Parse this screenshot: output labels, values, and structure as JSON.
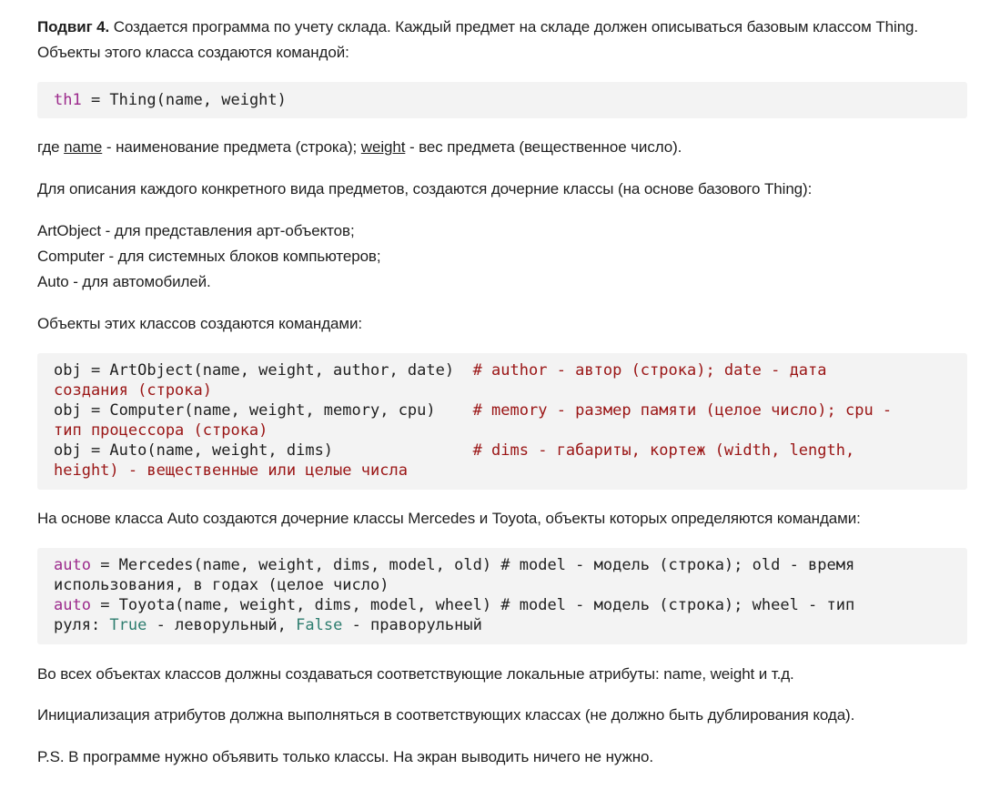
{
  "lead": {
    "title": "Подвиг 4.",
    "text": " Создается программа по учету склада. Каждый предмет на складе должен описываться базовым классом Thing. Объекты этого класса создаются командой:"
  },
  "code1": {
    "var": "th1",
    "rest": " = Thing(name, weight)"
  },
  "where": {
    "prefix": "где ",
    "name": "name",
    "mid": " - наименование предмета (строка); ",
    "weight": "weight",
    "suffix": " - вес предмета (вещественное число)."
  },
  "para_children": "Для описания каждого конкретного вида предметов, создаются дочерние классы (на основе базового Thing):",
  "list": [
    "ArtObject - для представления арт-объектов;",
    "Computer - для системных блоков компьютеров;",
    "Auto - для автомобилей."
  ],
  "para_objects": "Объекты этих классов создаются командами:",
  "code2": {
    "l1_code": "obj = ArtObject(name, weight, author, date)  ",
    "l1_comment": "# author - автор (строка); date - дата",
    "l2_comment": "создания (строка)",
    "l3_code": "obj = Computer(name, weight, memory, cpu)    ",
    "l3_comment": "# memory - размер памяти (целое число); cpu -",
    "l4_comment": "тип процессора (строка)",
    "l5_code": "obj = Auto(name, weight, dims)               ",
    "l5_comment": "# dims - габариты, кортеж (width, length,",
    "l6_comment": "height) - вещественные или целые числа"
  },
  "para_auto": "На основе класса Auto создаются дочерние классы Mercedes и Toyota, объекты которых определяются командами:",
  "code3": {
    "l1_var": "auto",
    "l1_rest": " = Mercedes(name, weight, dims, model, old) # model - модель (строка); old - время",
    "l2": "использования, в годах (целое число)",
    "l3_var": "auto",
    "l3_rest": " = Toyota(name, weight, dims, model, wheel) # model - модель (строка); wheel - тип",
    "l4_a": "руля: ",
    "l4_true": "True",
    "l4_b": " - леворульный, ",
    "l4_false": "False",
    "l4_c": " - праворульный"
  },
  "para_attrs": "Во всех объектах классов должны создаваться соответствующие локальные атрибуты: name, weight и т.д.",
  "para_init": "Инициализация атрибутов должна выполняться в соответствующих классах (не должно быть дублирования кода).",
  "para_ps": "P.S. В программе нужно объявить только классы. На экран выводить ничего не нужно.",
  "colors": {
    "code_bg": "#f3f3f3",
    "variable": "#9c2a8c",
    "comment": "#9a1515",
    "boolean": "#2e7d6f"
  }
}
